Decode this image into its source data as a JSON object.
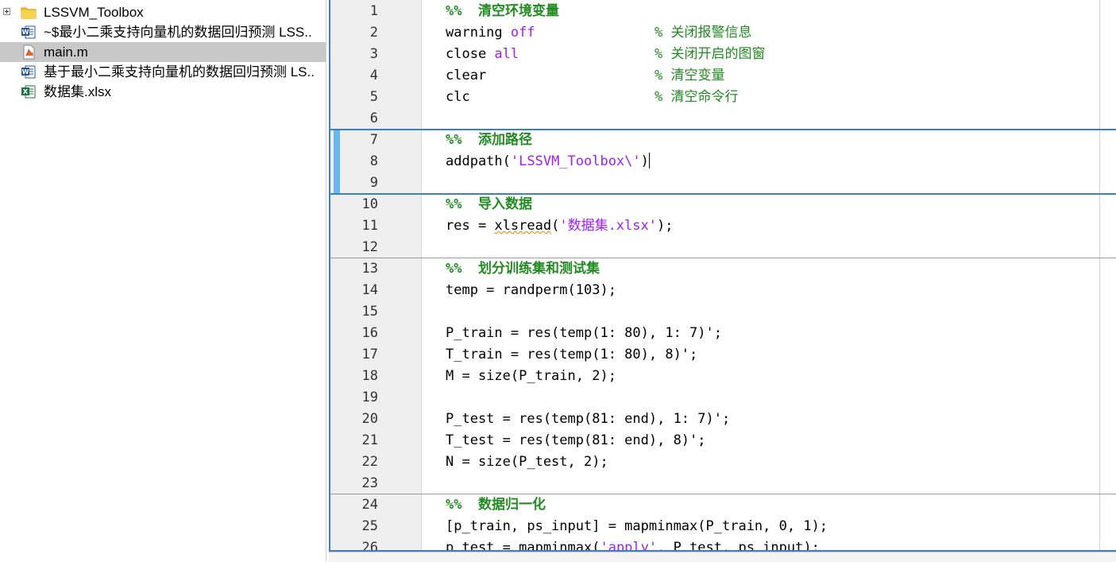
{
  "file_browser": {
    "items": [
      {
        "name": "LSSVM_Toolbox",
        "icon": "folder-icon",
        "expandable": true
      },
      {
        "name": "~$最小二乘支持向量机的数据回归预测 LSS..",
        "icon": "word-doc-icon"
      },
      {
        "name": "main.m",
        "icon": "matlab-file-icon",
        "selected": true
      },
      {
        "name": "基于最小二乘支持向量机的数据回归预测 LS..",
        "icon": "word-doc-icon"
      },
      {
        "name": "数据集.xlsx",
        "icon": "excel-file-icon"
      }
    ]
  },
  "editor": {
    "lines": [
      {
        "n": "1",
        "sec": "%%  清空环境变量"
      },
      {
        "n": "2",
        "a": "warning ",
        "kw": "off",
        "cm": "% 关闭报警信息"
      },
      {
        "n": "3",
        "a": "close ",
        "kw": "all",
        "cm": "% 关闭开启的图窗"
      },
      {
        "n": "4",
        "a": "clear",
        "cm": "% 清空变量"
      },
      {
        "n": "5",
        "a": "clc",
        "cm": "% 清空命令行"
      },
      {
        "n": "6"
      },
      {
        "n": "7",
        "sec": "%%  添加路径"
      },
      {
        "n": "8",
        "a": "addpath(",
        "str": "'LSSVM_Toolbox\\'",
        "b": ")"
      },
      {
        "n": "9"
      },
      {
        "n": "10",
        "sec": "%%  导入数据"
      },
      {
        "n": "11",
        "a": "res = ",
        "warn": "xlsread",
        "b": "(",
        "str": "'数据集.xlsx'",
        "c": ");"
      },
      {
        "n": "12"
      },
      {
        "n": "13",
        "sec": "%%  划分训练集和测试集"
      },
      {
        "n": "14",
        "a": "temp = randperm(103);"
      },
      {
        "n": "15"
      },
      {
        "n": "16",
        "a": "P_train = res(temp(1: 80), 1: 7)';"
      },
      {
        "n": "17",
        "a": "T_train = res(temp(1: 80), 8)';"
      },
      {
        "n": "18",
        "a": "M = size(P_train, 2);"
      },
      {
        "n": "19"
      },
      {
        "n": "20",
        "a": "P_test = res(temp(81: end), 1: 7)';"
      },
      {
        "n": "21",
        "a": "T_test = res(temp(81: end), 8)';"
      },
      {
        "n": "22",
        "a": "N = size(P_test, 2);"
      },
      {
        "n": "23"
      },
      {
        "n": "24",
        "sec": "%%  数据归一化"
      },
      {
        "n": "25",
        "a": "[p_train, ps_input] = mapminmax(P_train, 0, 1);"
      },
      {
        "n": "26",
        "a": "p_test = mapminmax(",
        "str": "'apply'",
        "b": ", P_test, ps_input);"
      }
    ]
  },
  "colors": {
    "keyword": "#a020f0",
    "string": "#a020f0",
    "comment": "#228b22",
    "accent": "#3c7fc4",
    "cell_bar": "#66b8ee",
    "selection": "#c8c8c8"
  }
}
